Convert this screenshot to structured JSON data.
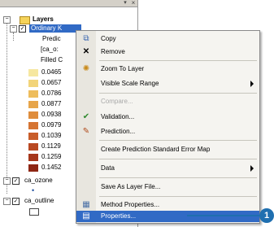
{
  "toc": {
    "root_label": "Layers",
    "layer1": {
      "label": "Ordinary K",
      "sub1": "Predic",
      "sub2": "[ca_o:",
      "sub3": "Filled C",
      "legend": [
        {
          "label": "0.0465",
          "color": "#f6e7a0"
        },
        {
          "label": "0.0657",
          "color": "#f2d479"
        },
        {
          "label": "0.0786",
          "color": "#eebd5c"
        },
        {
          "label": "0.0877",
          "color": "#e7a54a"
        },
        {
          "label": "0.0938",
          "color": "#df8d3d"
        },
        {
          "label": "0.0979",
          "color": "#d57433"
        },
        {
          "label": "0.1039",
          "color": "#c85d2a"
        },
        {
          "label": "0.1129",
          "color": "#b94822"
        },
        {
          "label": "0.1259",
          "color": "#a6361b"
        },
        {
          "label": "0.1452",
          "color": "#8e2614"
        }
      ]
    },
    "layer2": {
      "label": "ca_ozone"
    },
    "layer3": {
      "label": "ca_outline"
    }
  },
  "context_menu": {
    "items": [
      {
        "label": "Copy",
        "icon": "copy-icon",
        "disabled": false
      },
      {
        "label": "Remove",
        "icon": "remove-icon",
        "disabled": false
      },
      {
        "label": "Zoom To Layer",
        "icon": "zoom-icon",
        "disabled": false
      },
      {
        "label": "Visible Scale Range",
        "icon": "",
        "disabled": false,
        "submenu": true
      },
      {
        "label": "Compare...",
        "icon": "",
        "disabled": true
      },
      {
        "label": "Validation...",
        "icon": "validation-icon",
        "disabled": false
      },
      {
        "label": "Prediction...",
        "icon": "prediction-icon",
        "disabled": false
      },
      {
        "label": "Create Prediction Standard Error Map",
        "icon": "",
        "disabled": false
      },
      {
        "label": "Data",
        "icon": "",
        "disabled": false,
        "submenu": true
      },
      {
        "label": "Save As Layer File...",
        "icon": "",
        "disabled": false
      },
      {
        "label": "Method Properties...",
        "icon": "method-properties-icon",
        "disabled": false
      },
      {
        "label": "Properties...",
        "icon": "properties-icon",
        "disabled": false,
        "selected": true
      }
    ]
  },
  "callout": {
    "number": "1"
  },
  "colors": {
    "selection": "#316ac5",
    "callout": "#1f6fb0"
  }
}
